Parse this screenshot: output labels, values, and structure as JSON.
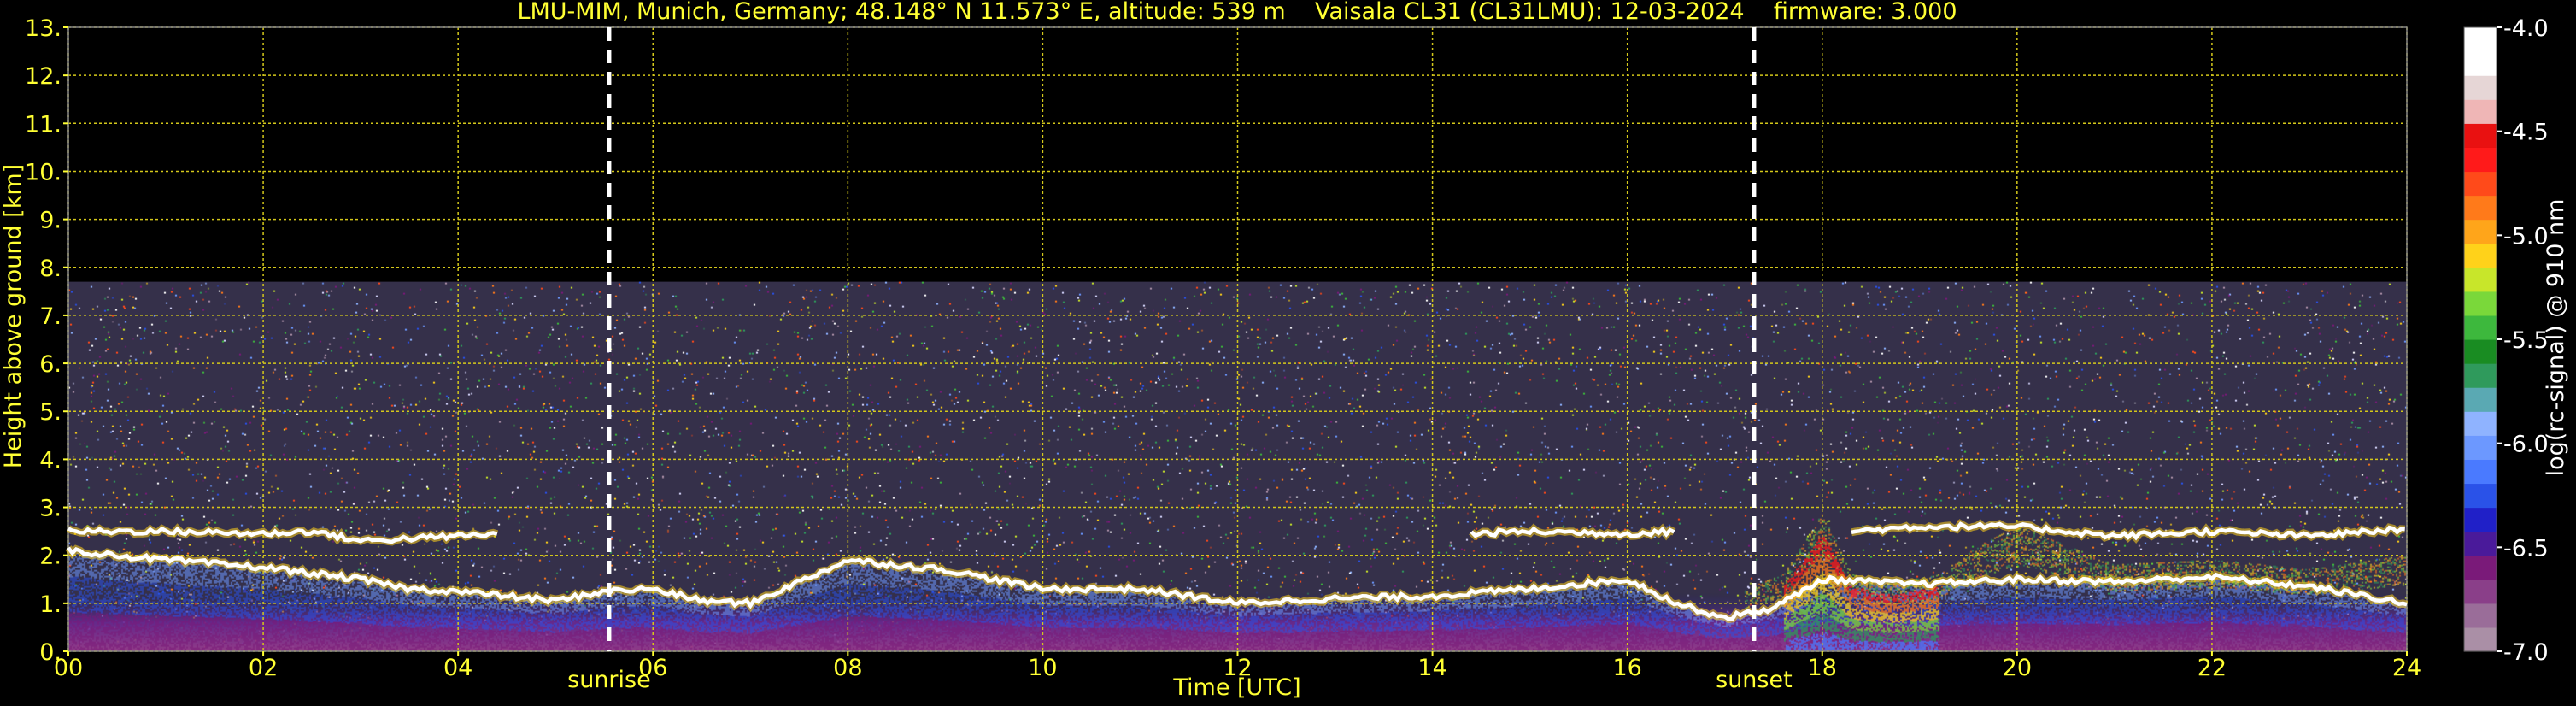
{
  "chart_data": {
    "type": "heatmap",
    "title": "LMU-MIM, Munich, Germany; 48.148° N 11.573° E, altitude: 539 m    Vaisala CL31 (CL31LMU): 12-03-2024    firmware: 3.000",
    "xlabel": "Time [UTC]",
    "ylabel": "Height above ground [km]",
    "xlim": [
      0,
      24
    ],
    "ylim": [
      0,
      13
    ],
    "x_ticks": [
      "00",
      "02",
      "04",
      "06",
      "08",
      "10",
      "12",
      "14",
      "16",
      "18",
      "20",
      "22",
      "24"
    ],
    "y_ticks": [
      "0.",
      "1.",
      "2.",
      "3.",
      "4.",
      "5.",
      "6.",
      "7.",
      "8.",
      "9.",
      "10.",
      "11.",
      "12.",
      "13."
    ],
    "grid": true,
    "data_top_km": 7.7,
    "markers": [
      {
        "label": "sunrise",
        "time": 5.55
      },
      {
        "label": "sunset",
        "time": 17.3
      }
    ],
    "colorbar": {
      "label": "log(rc-signal) @ 910 nm",
      "ticks": [
        "-4.0",
        "-4.5",
        "-5.0",
        "-5.5",
        "-6.0",
        "-6.5",
        "-7.0"
      ],
      "range": [
        -7.0,
        -4.0
      ],
      "colors": [
        "#aa8fa6",
        "#9a6d99",
        "#8a3f89",
        "#7a1a79",
        "#4a1a9a",
        "#2020c8",
        "#2a52e8",
        "#4a7aff",
        "#6c98ff",
        "#8fb3ff",
        "#5aa9b3",
        "#2f9a5c",
        "#198c22",
        "#3db83d",
        "#7ad83a",
        "#c8e62a",
        "#ffd21a",
        "#ffa51a",
        "#ff7a1a",
        "#ff4a1a",
        "#ff1a1a",
        "#e91111",
        "#efb6b6",
        "#e6d6d6",
        "#ffffff",
        "#ffffff"
      ]
    },
    "layers": [
      {
        "name": "boundary-layer-top",
        "points": [
          [
            0,
            2.1
          ],
          [
            1,
            1.9
          ],
          [
            2,
            1.75
          ],
          [
            3,
            1.5
          ],
          [
            3.5,
            1.3
          ],
          [
            4,
            1.25
          ],
          [
            5,
            1.05
          ],
          [
            5.5,
            1.25
          ],
          [
            6,
            1.3
          ],
          [
            6.5,
            1.05
          ],
          [
            7,
            1.0
          ],
          [
            8,
            1.9
          ],
          [
            9,
            1.7
          ],
          [
            10,
            1.3
          ],
          [
            11,
            1.3
          ],
          [
            12,
            1.0
          ],
          [
            13,
            1.1
          ],
          [
            14,
            1.15
          ],
          [
            15,
            1.3
          ],
          [
            16,
            1.5
          ],
          [
            16.5,
            1.0
          ],
          [
            17,
            0.7
          ],
          [
            17.5,
            0.9
          ],
          [
            18,
            1.5
          ],
          [
            19,
            1.4
          ],
          [
            20,
            1.5
          ],
          [
            21,
            1.45
          ],
          [
            22,
            1.55
          ],
          [
            23,
            1.35
          ],
          [
            24,
            1.0
          ]
        ]
      },
      {
        "name": "elevated-layer",
        "points": [
          [
            0,
            2.5
          ],
          [
            1,
            2.5
          ],
          [
            2,
            2.45
          ],
          [
            2.5,
            2.5
          ],
          [
            3,
            2.3
          ],
          [
            4,
            2.4
          ],
          [
            4.4,
            2.45
          ]
        ]
      },
      {
        "name": "elevated-layer-2",
        "points": [
          [
            14.4,
            2.45
          ],
          [
            15,
            2.5
          ],
          [
            16,
            2.45
          ],
          [
            16.5,
            2.5
          ]
        ]
      },
      {
        "name": "elevated-layer-3",
        "points": [
          [
            18.3,
            2.5
          ],
          [
            19,
            2.6
          ],
          [
            20,
            2.6
          ],
          [
            21,
            2.4
          ],
          [
            22,
            2.5
          ],
          [
            23,
            2.4
          ],
          [
            24,
            2.55
          ]
        ]
      }
    ]
  }
}
